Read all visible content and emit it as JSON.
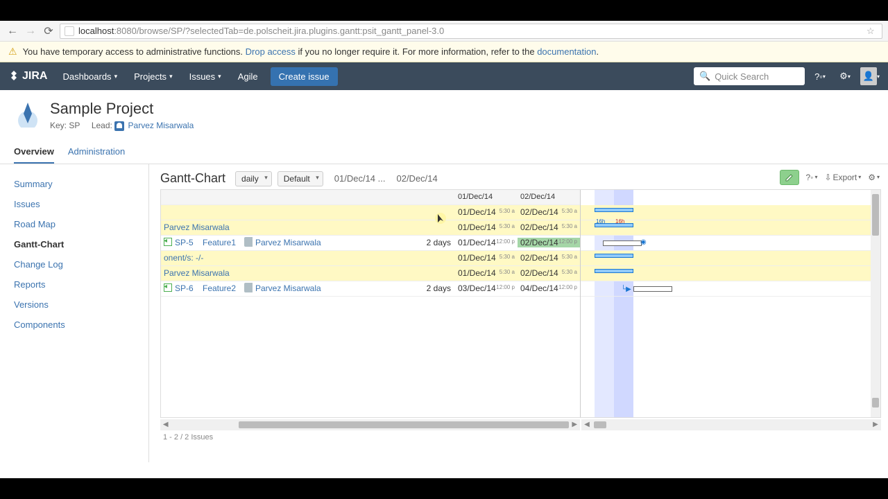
{
  "browser": {
    "url_host": "localhost",
    "url_path": ":8080/browse/SP/?selectedTab=de.polscheit.jira.plugins.gantt:psit_gantt_panel-3.0"
  },
  "banner": {
    "text1": "You have temporary access to administrative functions.",
    "link1": "Drop access",
    "text2": "if you no longer require it. For more information, refer to the",
    "link2": "documentation",
    "text3": "."
  },
  "nav": {
    "logo": "JIRA",
    "items": [
      "Dashboards",
      "Projects",
      "Issues",
      "Agile"
    ],
    "create": "Create issue",
    "search_placeholder": "Quick Search"
  },
  "project": {
    "name": "Sample Project",
    "key_label": "Key:",
    "key": "SP",
    "lead_label": "Lead:",
    "lead": "Parvez Misarwala"
  },
  "tabs": {
    "overview": "Overview",
    "admin": "Administration"
  },
  "sidebar": {
    "items": [
      "Summary",
      "Issues",
      "Road Map",
      "Gantt-Chart",
      "Change Log",
      "Reports",
      "Versions",
      "Components"
    ],
    "active": 3
  },
  "gantt": {
    "title": "Gantt-Chart",
    "view": "daily",
    "style": "Default",
    "range_from": "01/Dec/14 ...",
    "range_to": "02/Dec/14",
    "export": "Export",
    "header_date1": "01/Dec/14",
    "header_date2": "02/Dec/14",
    "rows": [
      {
        "type": "group",
        "label": "",
        "start": "01/Dec/14",
        "st": "5:30 a",
        "end": "02/Dec/14",
        "et": "5:30 a"
      },
      {
        "type": "group",
        "label": "Parvez Misarwala",
        "start": "01/Dec/14",
        "st": "5:30 a",
        "end": "02/Dec/14",
        "et": "5:30 a"
      },
      {
        "type": "task",
        "key": "SP-5",
        "summary": "Feature1",
        "assignee": "Parvez Misarwala",
        "dur": "2 days",
        "start": "01/Dec/14",
        "st": "12:00 p",
        "end": "02/Dec/14",
        "et": "12:00 p",
        "endGreen": true
      },
      {
        "type": "group",
        "label": "onent/s: -/-",
        "start": "01/Dec/14",
        "st": "5:30 a",
        "end": "02/Dec/14",
        "et": "5:30 a"
      },
      {
        "type": "group",
        "label": "Parvez Misarwala",
        "start": "01/Dec/14",
        "st": "5:30 a",
        "end": "02/Dec/14",
        "et": "5:30 a"
      },
      {
        "type": "task",
        "key": "SP-6",
        "summary": "Feature2",
        "assignee": "Parvez Misarwala",
        "dur": "2 days",
        "start": "03/Dec/14",
        "st": "12:00 p",
        "end": "04/Dec/14",
        "et": "12:00 p"
      }
    ],
    "badge16h": "16h",
    "footer": "1 - 2 / 2 Issues"
  }
}
